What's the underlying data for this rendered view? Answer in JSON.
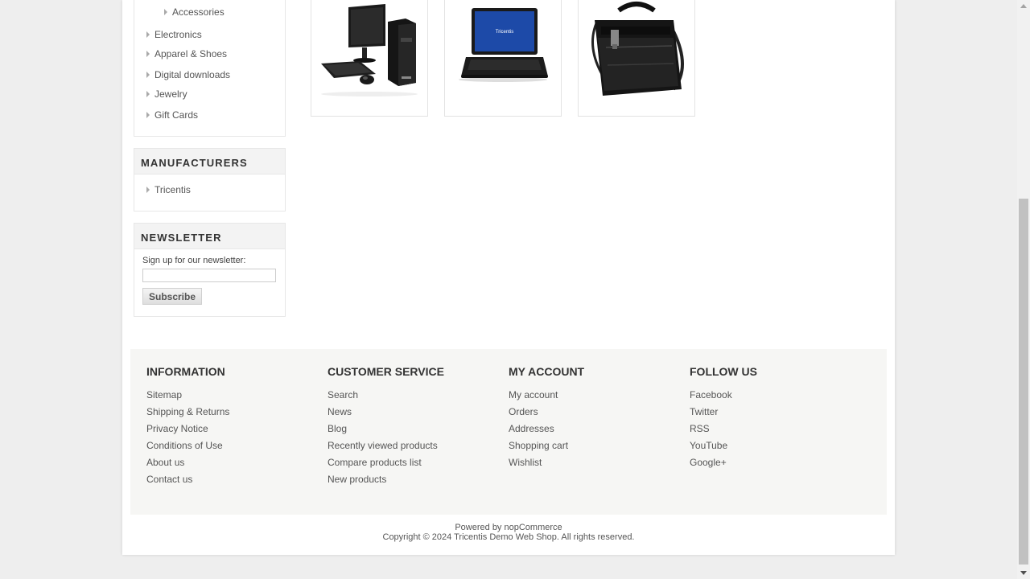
{
  "categories": {
    "items": [
      {
        "label": "Accessories",
        "level": 2
      },
      {
        "label": "Electronics",
        "level": 1
      },
      {
        "label": "Apparel & Shoes",
        "level": 1
      },
      {
        "label": "Digital downloads",
        "level": 1
      },
      {
        "label": "Jewelry",
        "level": 1
      },
      {
        "label": "Gift Cards",
        "level": 1
      }
    ]
  },
  "manufacturers": {
    "title": "MANUFACTURERS",
    "items": [
      {
        "label": "Tricentis"
      }
    ]
  },
  "newsletter": {
    "title": "NEWSLETTER",
    "label": "Sign up for our newsletter:",
    "input_value": "",
    "button_label": "Subscribe"
  },
  "products": [
    {
      "image": "desktop-computer"
    },
    {
      "image": "laptop",
      "screen_text": "Tricentis"
    },
    {
      "image": "laptop-bag"
    }
  ],
  "footer": {
    "columns": [
      {
        "title": "INFORMATION",
        "links": [
          "Sitemap",
          "Shipping & Returns",
          "Privacy Notice",
          "Conditions of Use",
          "About us",
          "Contact us"
        ]
      },
      {
        "title": "CUSTOMER SERVICE",
        "links": [
          "Search",
          "News",
          "Blog",
          "Recently viewed products",
          "Compare products list",
          "New products"
        ]
      },
      {
        "title": "MY ACCOUNT",
        "links": [
          "My account",
          "Orders",
          "Addresses",
          "Shopping cart",
          "Wishlist"
        ]
      },
      {
        "title": "FOLLOW US",
        "links": [
          "Facebook",
          "Twitter",
          "RSS",
          "YouTube",
          "Google+"
        ]
      }
    ],
    "powered_by": "Powered by nopCommerce",
    "copyright": "Copyright © 2024 Tricentis Demo Web Shop. All rights reserved."
  },
  "colors": {
    "page_background": "#eeeeee",
    "block_title_background": "#f3f3f3",
    "footer_background": "#f6f6f4",
    "laptop_screen": "#1d4aa8"
  },
  "icons": [
    "list-arrow-icon",
    "scroll-up-icon",
    "scroll-down-icon"
  ]
}
